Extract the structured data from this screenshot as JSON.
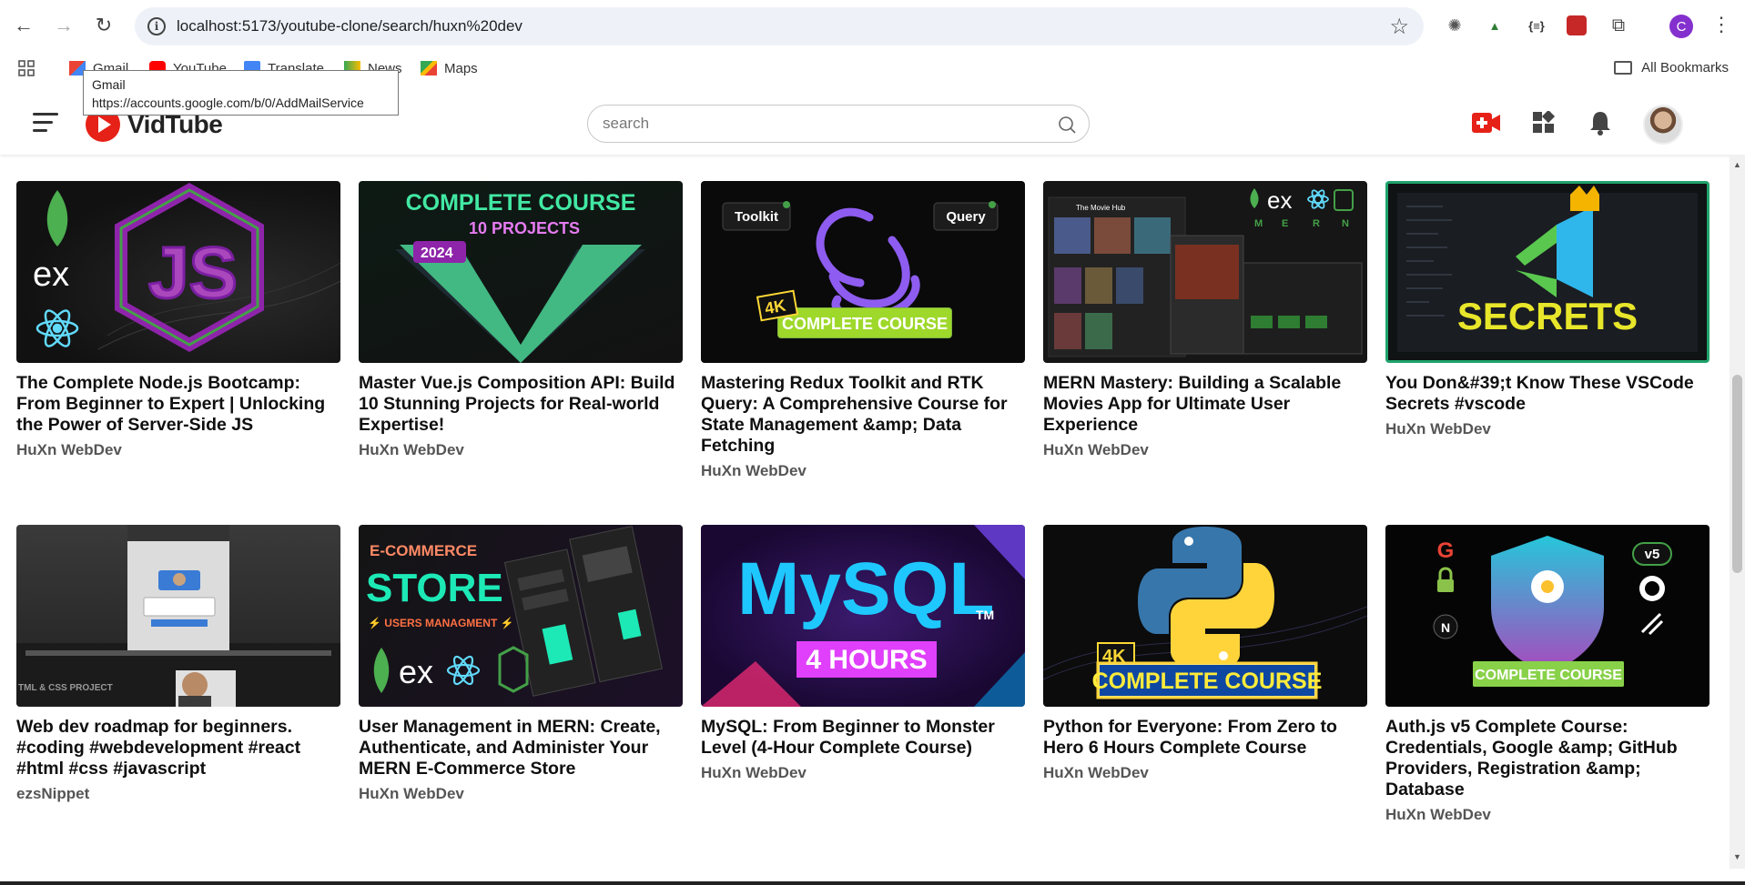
{
  "browser": {
    "url": "localhost:5173/youtube-clone/search/huxn%20dev",
    "bookmarks": [
      "Gmail",
      "YouTube",
      "Translate",
      "News",
      "Maps"
    ],
    "all_bookmarks_label": "All Bookmarks",
    "profile_initial": "C",
    "tooltip": {
      "title": "Gmail",
      "url": "https://accounts.google.com/b/0/AddMailService"
    }
  },
  "header": {
    "logo_text": "VidTube",
    "search_placeholder": "search"
  },
  "videos": [
    {
      "title": "The Complete Node.js Bootcamp: From Beginner to Expert | Unlocking the Power of Server-Side JS",
      "channel": "HuXn WebDev"
    },
    {
      "title": "Master Vue.js Composition API: Build 10 Stunning Projects for Real-world Expertise!",
      "channel": "HuXn WebDev"
    },
    {
      "title": "Mastering Redux Toolkit and RTK Query: A Comprehensive Course for State Management &amp; Data Fetching",
      "channel": "HuXn WebDev"
    },
    {
      "title": "MERN Mastery: Building a Scalable Movies App for Ultimate User Experience",
      "channel": "HuXn WebDev"
    },
    {
      "title": "You Don&#39;t Know These VSCode Secrets #vscode",
      "channel": "HuXn WebDev"
    },
    {
      "title": "Web dev roadmap for beginners. #coding #webdevelopment #react #html #css #javascript",
      "channel": "ezsNippet"
    },
    {
      "title": "User Management in MERN: Create, Authenticate, and Administer Your MERN E-Commerce Store",
      "channel": "HuXn WebDev"
    },
    {
      "title": "MySQL: From Beginner to Monster Level (4-Hour Complete Course)",
      "channel": "HuXn WebDev"
    },
    {
      "title": "Python for Everyone: From Zero to Hero 6 Hours Complete Course",
      "channel": "HuXn WebDev"
    },
    {
      "title": "Auth.js v5 Complete Course: Credentials, Google &amp; GitHub Providers, Registration &amp; Database",
      "channel": "HuXn WebDev"
    }
  ],
  "thumbs": {
    "vue_line1": "COMPLETE COURSE",
    "vue_line2": "10 PROJECTS",
    "vue_year": "2024",
    "redux_toolkit": "Toolkit",
    "redux_query": "Query",
    "redux_4k": "4K",
    "redux_course": "COMPLETE COURSE",
    "mern_letters": [
      "M",
      "E",
      "R",
      "N"
    ],
    "mern_poster_title": "The Movie Hub",
    "vscode_secrets": "SECRETS",
    "webdev_caption": "TML & CSS PROJECT",
    "store_line1": "E-COMMERCE",
    "store_line2": "STORE",
    "store_line3": "⚡ USERS MANAGMENT ⚡",
    "mysql_logo": "MySQL",
    "mysql_tm": "TM",
    "mysql_hours": "4 HOURS",
    "python_4k": "4K",
    "python_course": "COMPLETE COURSE",
    "auth_v5": "v5",
    "auth_course": "COMPLETE COURSE",
    "js_ex": "ex"
  },
  "colors": {
    "accent_red": "#e62117",
    "vue_green": "#42b883",
    "node_green": "#4caf50",
    "redux_purple": "#764abc",
    "mysql_cyan": "#1ec8ff",
    "mysql_magenta": "#e040fb",
    "python_yellow": "#ffd43b",
    "python_blue": "#3776ab"
  }
}
